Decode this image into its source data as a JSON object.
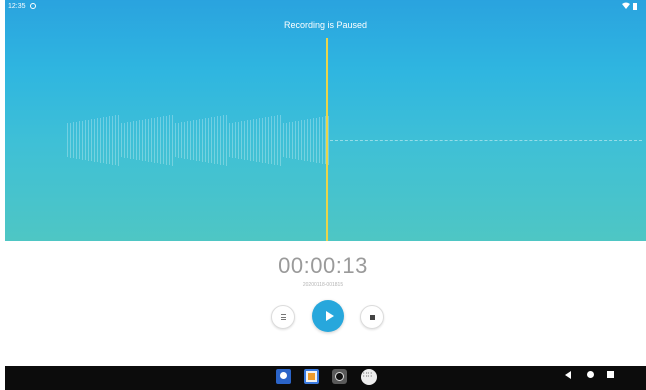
{
  "status_bar": {
    "time": "12:35"
  },
  "recorder": {
    "title": "Recording is Paused",
    "elapsed": "00:00:13",
    "filename": "20200118-001815"
  },
  "colors": {
    "accent": "#27a7dc",
    "playhead": "#e9d54a"
  },
  "icons": {
    "list": "list-icon",
    "play": "play-icon",
    "stop": "stop-icon",
    "back": "back-icon",
    "home": "home-icon",
    "recents": "recents-icon"
  }
}
